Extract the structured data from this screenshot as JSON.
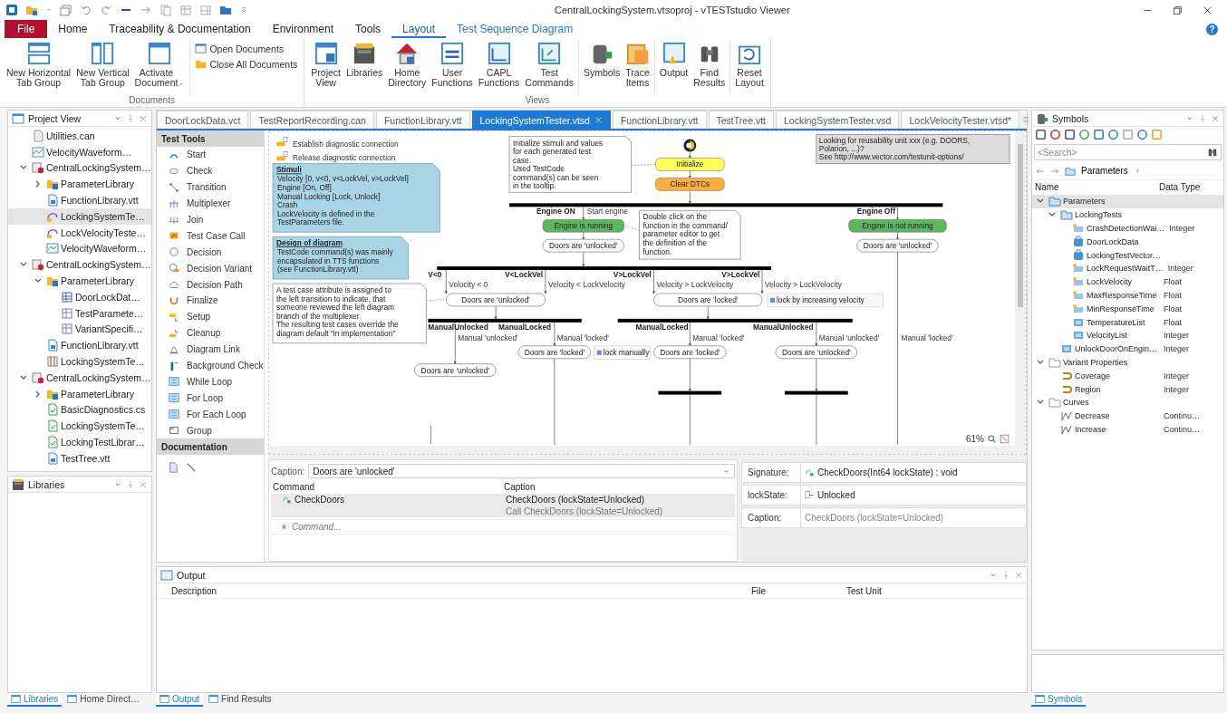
{
  "window": {
    "title": "CentralLockingSystem.vtsoproj - vTESTstudio Viewer"
  },
  "menu_tabs": [
    {
      "label": "File",
      "kind": "file",
      "selected": false
    },
    {
      "label": "Home",
      "kind": "tab",
      "selected": false
    },
    {
      "label": "Traceability & Documentation",
      "kind": "tab",
      "selected": false
    },
    {
      "label": "Environment",
      "kind": "tab",
      "selected": false
    },
    {
      "label": "Tools",
      "kind": "tab",
      "selected": false
    },
    {
      "label": "Layout",
      "kind": "tab",
      "selected": true
    },
    {
      "label": "Test Sequence Diagram",
      "kind": "contextual",
      "selected": false
    }
  ],
  "help": "?",
  "ribbon": [
    {
      "label": "Documents",
      "sets": [
        [
          {
            "label": "New Horizontal\nTab Group",
            "kind": "large"
          },
          {
            "label": "New Vertical\nTab Group",
            "kind": "large"
          },
          {
            "label": "Activate\nDocument",
            "kind": "split"
          }
        ],
        [
          {
            "label": "Open Documents",
            "kind": "small"
          },
          {
            "label": "Close All Documents",
            "kind": "small"
          }
        ]
      ]
    },
    {
      "label": "Views",
      "sets": [
        [
          {
            "label": "Project\nView",
            "kind": "large"
          },
          {
            "label": "Libraries",
            "kind": "large"
          },
          {
            "label": "Home\nDirectory",
            "kind": "large"
          },
          {
            "label": "User\nFunctions",
            "kind": "large"
          },
          {
            "label": "CAPL\nFunctions",
            "kind": "large"
          },
          {
            "label": "Test\nCommands",
            "kind": "large"
          }
        ],
        [
          {
            "label": "Symbols",
            "kind": "large"
          },
          {
            "label": "Trace\nItems",
            "kind": "large"
          }
        ],
        [
          {
            "label": "Output",
            "kind": "large"
          },
          {
            "label": "Find\nResults",
            "kind": "large"
          }
        ],
        [
          {
            "label": "Reset\nLayout",
            "kind": "large"
          }
        ]
      ]
    }
  ],
  "project_view": {
    "title": "Project View",
    "tree": [
      {
        "label": "Utilities.can",
        "kind": "can",
        "selected": false
      },
      {
        "label": "VelocityWaveform…",
        "kind": "waveform",
        "selected": false
      },
      {
        "label": "CentralLockingSystem…",
        "kind": "project",
        "expanded": true,
        "selected": false,
        "children": [
          {
            "label": "ParameterLibrary",
            "kind": "library",
            "expanded": false,
            "selected": false
          },
          {
            "label": "FunctionLibrary.vtt",
            "kind": "vtt",
            "selected": false
          },
          {
            "label": "LockingSystemTe…",
            "kind": "vtsd",
            "selected": true
          },
          {
            "label": "LockVelocityTeste…",
            "kind": "vtsd",
            "selected": false
          },
          {
            "label": "VelocityWaveform…",
            "kind": "waveform",
            "selected": false
          }
        ]
      },
      {
        "label": "CentralLockingSystem…",
        "kind": "project",
        "expanded": true,
        "selected": false,
        "children": [
          {
            "label": "ParameterLibrary",
            "kind": "library",
            "expanded": true,
            "selected": false,
            "children": [
              {
                "label": "DoorLockDat…",
                "kind": "data",
                "selected": false
              },
              {
                "label": "TestParamete…",
                "kind": "param",
                "selected": false
              },
              {
                "label": "VariantSpecifi…",
                "kind": "param",
                "selected": false
              }
            ]
          },
          {
            "label": "FunctionLibrary.vtt",
            "kind": "vtt",
            "selected": false
          },
          {
            "label": "LockingSystemTe…",
            "kind": "table",
            "selected": false
          }
        ]
      },
      {
        "label": "CentralLockingSystem…",
        "kind": "project",
        "expanded": true,
        "selected": false,
        "children": [
          {
            "label": "ParameterLibrary",
            "kind": "library",
            "expanded": false,
            "selected": false
          },
          {
            "label": "BasicDiagnostics.cs",
            "kind": "cs",
            "selected": false
          },
          {
            "label": "LockingSystemTe…",
            "kind": "cs",
            "selected": false
          },
          {
            "label": "LockingTestLibrar…",
            "kind": "cs",
            "selected": false
          },
          {
            "label": "TestTree.vtt",
            "kind": "vtt",
            "selected": false
          }
        ]
      }
    ]
  },
  "libraries": {
    "title": "Libraries"
  },
  "document_tabs": [
    {
      "label": "DoorLockData.vct",
      "selected": false
    },
    {
      "label": "TestReportRecording.can",
      "selected": false
    },
    {
      "label": "FunctionLibrary.vtt",
      "selected": false
    },
    {
      "label": "LockingSystemTester.vtsd",
      "selected": true
    },
    {
      "label": "FunctionLibrary.vtt",
      "selected": false
    },
    {
      "label": "TestTree.vtt",
      "selected": false
    },
    {
      "label": "LockingSystemTester.vsd",
      "selected": false
    },
    {
      "label": "LockVelocityTester.vtsd*",
      "selected": false
    }
  ],
  "palette": [
    {
      "title": "Test Tools",
      "items": [
        {
          "label": "Start",
          "kind": "start"
        },
        {
          "label": "Check",
          "kind": "check"
        },
        {
          "label": "Transition",
          "kind": "transition"
        },
        {
          "label": "Multiplexer",
          "kind": "multiplexer"
        },
        {
          "label": "Join",
          "kind": "join"
        },
        {
          "label": "Test Case Call",
          "kind": "testcase"
        },
        {
          "label": "Decision",
          "kind": "decision"
        },
        {
          "label": "Decision Variant",
          "kind": "variant"
        },
        {
          "label": "Decision Path",
          "kind": "path"
        },
        {
          "label": "Finalize",
          "kind": "finalize"
        },
        {
          "label": "Setup",
          "kind": "setup"
        },
        {
          "label": "Cleanup",
          "kind": "cleanup"
        },
        {
          "label": "Diagram Link",
          "kind": "link"
        },
        {
          "label": "Background Check",
          "kind": "background"
        },
        {
          "label": "While Loop",
          "kind": "loop"
        },
        {
          "label": "For Loop",
          "kind": "loop"
        },
        {
          "label": "For Each Loop",
          "kind": "loop"
        },
        {
          "label": "Group",
          "kind": "group"
        }
      ]
    },
    {
      "title": "Documentation",
      "items": [
        {
          "kind": "comment"
        },
        {
          "kind": "line"
        }
      ]
    }
  ],
  "diagram": {
    "zoom": "61%",
    "legend": [
      {
        "text": "Establish diagnostic connection"
      },
      {
        "text": "Release diagnostic connection"
      }
    ],
    "side_notes": [
      {
        "kind": "blue-note",
        "title": "Stimuli",
        "lines": [
          "Velocity       [0, v<0, v<LockVel, v>LockVel]",
          "Engine          [On, Off]",
          "Manual Locking [Lock, Unlock]",
          "Crash",
          "LockVelocity is defined in the",
          "TestParameters file."
        ]
      },
      {
        "kind": "blue-note",
        "title": "Design of diagram",
        "lines": [
          "TestCode command(s) was mainly",
          "encapsulated in TTS functions",
          "(see FunctionLibrary.vtt)"
        ]
      },
      {
        "kind": "note",
        "lines": [
          "A test case attribute is assigned to",
          "the left transition to indicate, that",
          "someone reviewed the left diagram",
          "branch of the multiplexer.",
          "The resulting test cases override the",
          "diagram default \"in implementation\""
        ]
      }
    ],
    "elements": [
      {
        "kind": "note",
        "lines": [
          "Initialize stimuli and values",
          "for each generated test",
          "case.",
          "Used TestCode",
          "command(s) can be seen",
          "in the tooltip."
        ]
      },
      {
        "kind": "start"
      },
      {
        "kind": "action",
        "text": "Initialize",
        "color": "#ffff55"
      },
      {
        "kind": "action",
        "text": "Clear DTCs",
        "color": "#ffae3a"
      },
      {
        "kind": "info",
        "lines": [
          "Looking for reusability unit xxx (e.g. DOORS,",
          "Polarion, ...)?",
          "See http://www.vector.com/testunit-options/"
        ]
      },
      {
        "kind": "bar"
      },
      {
        "kind": "label",
        "text": "Engine ON"
      },
      {
        "kind": "guard",
        "text": "Start engine"
      },
      {
        "kind": "action",
        "text": "Engine is running",
        "color": "#5cb85c"
      },
      {
        "kind": "check",
        "text": "Doors are 'unlocked'"
      },
      {
        "kind": "note",
        "lines": [
          "Double click on the",
          "function in the command/",
          "parameter editor to get",
          "the definition of the",
          "function."
        ]
      },
      {
        "kind": "label",
        "text": "Engine Off"
      },
      {
        "kind": "action",
        "text": "Engine is not running",
        "color": "#5cb85c"
      },
      {
        "kind": "check",
        "text": "Doors are 'unlocked'"
      },
      {
        "kind": "bar"
      },
      {
        "kind": "label",
        "text": "V<0"
      },
      {
        "kind": "label",
        "text": "V<LockVel"
      },
      {
        "kind": "label",
        "text": "V>LockVel"
      },
      {
        "kind": "label",
        "text": "V>LockVel"
      },
      {
        "kind": "guard",
        "text": "Velocity < 0"
      },
      {
        "kind": "guard",
        "text": "Velocity < LockVelocity"
      },
      {
        "kind": "guard",
        "text": "Velocity > LockVelocity"
      },
      {
        "kind": "guard",
        "text": "Velocity > LockVelocity"
      },
      {
        "kind": "check",
        "text": "Doors are 'unlocked'"
      },
      {
        "kind": "check",
        "text": "Doors are 'locked'"
      },
      {
        "kind": "tag",
        "text": "lock by increasing velocity"
      },
      {
        "kind": "bar"
      },
      {
        "kind": "bar"
      },
      {
        "kind": "label",
        "text": "ManualUnlocked"
      },
      {
        "kind": "label",
        "text": "ManualLocked"
      },
      {
        "kind": "label",
        "text": "ManualLocked"
      },
      {
        "kind": "label",
        "text": "ManualUnlocked"
      },
      {
        "kind": "guard",
        "text": "Manual 'unlocked'"
      },
      {
        "kind": "guard",
        "text": "Manual 'locked'"
      },
      {
        "kind": "guard",
        "text": "Manual 'locked'"
      },
      {
        "kind": "guard",
        "text": "Manual 'unlocked'"
      },
      {
        "kind": "guard",
        "text": "Manual 'locked'"
      },
      {
        "kind": "check",
        "text": "Doors are 'locked'"
      },
      {
        "kind": "tag",
        "text": "lock manually"
      },
      {
        "kind": "check",
        "text": "Doors are 'locked'"
      },
      {
        "kind": "check",
        "text": "Doors are 'unlocked'"
      },
      {
        "kind": "check",
        "text": "Doors are 'unlocked'"
      },
      {
        "kind": "bar"
      },
      {
        "kind": "bar"
      }
    ]
  },
  "editor": {
    "caption_label": "Caption:",
    "caption_value": "Doors are 'unlocked'",
    "columns": [
      "Command",
      "Caption"
    ],
    "rows": [
      {
        "command": "CheckDoors",
        "caption": "CheckDoors (lockState=Unlocked)",
        "caption_detail": "Call CheckDoors (lockState=Unlocked)",
        "selected": true
      }
    ],
    "new_row_placeholder": "Command..."
  },
  "properties": [
    {
      "label": "Signature:",
      "value": "CheckDoors(Int64 lockState) : void",
      "kind": "function",
      "disabled": false
    },
    {
      "label": "lockState:",
      "value": "Unlocked",
      "kind": "enum",
      "disabled": false
    },
    {
      "label": "Caption:",
      "value": "CheckDoors (lockState=Unlocked)",
      "kind": "text",
      "disabled": true
    }
  ],
  "output": {
    "title": "Output",
    "columns": [
      "Description",
      "File",
      "Test Unit"
    ]
  },
  "symbols": {
    "title": "Symbols",
    "search_placeholder": "<Search>",
    "breadcrumb": "Parameters",
    "columns": [
      "Name",
      "Data Type"
    ],
    "tree": [
      {
        "label": "Parameters",
        "kind": "folder",
        "expanded": true,
        "selected": true,
        "children": [
          {
            "label": "LockingTests",
            "kind": "folder",
            "expanded": true,
            "selected": false,
            "children": [
              {
                "label": "CrashDetectionWai…",
                "kind": "param",
                "type": "Integer",
                "selected": false
              },
              {
                "label": "DoorLockData",
                "kind": "struct",
                "selected": false
              },
              {
                "label": "LockingTestVector…",
                "kind": "struct",
                "selected": false
              },
              {
                "label": "LockRequestWaitT…",
                "kind": "param",
                "type": "Integer",
                "selected": false
              },
              {
                "label": "LockVelocity",
                "kind": "param",
                "type": "Float",
                "selected": false
              },
              {
                "label": "MaxResponseTime",
                "kind": "param",
                "type": "Float",
                "selected": false
              },
              {
                "label": "MinResponseTime",
                "kind": "param",
                "type": "Float",
                "selected": false
              },
              {
                "label": "TemperatureList",
                "kind": "list",
                "type": "Float",
                "selected": false
              },
              {
                "label": "VelocityList",
                "kind": "list",
                "type": "Integer",
                "selected": false
              }
            ]
          },
          {
            "label": "UnlockDoorOnEngin…",
            "kind": "list",
            "type": "Integer",
            "selected": false
          }
        ]
      },
      {
        "label": "Variant Properties",
        "kind": "vfolder",
        "expanded": true,
        "selected": false,
        "children": [
          {
            "label": "Coverage",
            "kind": "variant",
            "type": "Integer",
            "selected": false
          },
          {
            "label": "Region",
            "kind": "variant",
            "type": "Integer",
            "selected": false
          }
        ]
      },
      {
        "label": "Curves",
        "kind": "vfolder",
        "expanded": true,
        "selected": false,
        "children": [
          {
            "label": "Decrease",
            "kind": "curve",
            "type": "Continu…",
            "selected": false
          },
          {
            "label": "Increase",
            "kind": "curve",
            "type": "Continu…",
            "selected": false
          }
        ]
      }
    ]
  },
  "bottom_tabs": {
    "left": [
      {
        "label": "Libraries",
        "selected": true
      },
      {
        "label": "Home Direct…",
        "selected": false
      }
    ],
    "center": [
      {
        "label": "Output",
        "selected": true
      },
      {
        "label": "Find Results",
        "selected": false
      }
    ],
    "right": [
      {
        "label": "Symbols",
        "selected": true
      }
    ]
  }
}
